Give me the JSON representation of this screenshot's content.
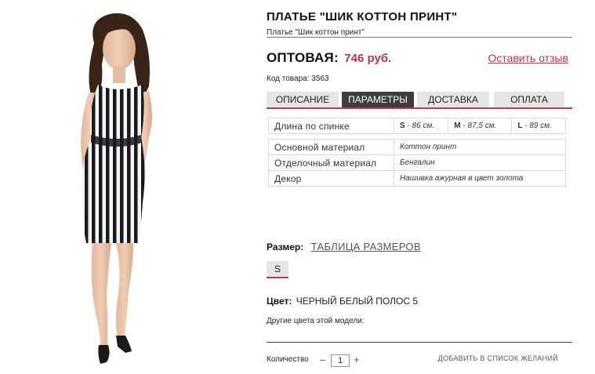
{
  "product": {
    "title": "ПЛАТЬЕ \"ШИК КОТТОН ПРИНТ\"",
    "subtitle": "Платье \"Шик коттон принт\"",
    "price_label": "ОПТОВАЯ:",
    "price_value": "746 руб.",
    "review_link": "Оставить отзыв",
    "sku": "Код товара: 3563"
  },
  "tabs": [
    {
      "label": "ОПИСАНИЕ",
      "active": false
    },
    {
      "label": "ПАРАМЕТРЫ",
      "active": true
    },
    {
      "label": "ДОСТАВКА",
      "active": false
    },
    {
      "label": "ОПЛАТА",
      "active": false
    }
  ],
  "length": {
    "label": "Длина по спинке",
    "sizes": [
      {
        "size": "S",
        "value": " - 86 см."
      },
      {
        "size": "M",
        "value": " - 87,5 см."
      },
      {
        "size": "L",
        "value": " - 89 см."
      }
    ]
  },
  "materials": [
    {
      "label": "Основной материал",
      "value": "Коттон принт"
    },
    {
      "label": "Отделочный материал",
      "value": "Бенгалин"
    },
    {
      "label": "Декор",
      "value": "Нашивка ажурная в цвет золота"
    }
  ],
  "size": {
    "label": "Размер:",
    "chart_link": "ТАБЛИЦА РАЗМЕРОВ",
    "options": [
      "S"
    ]
  },
  "color": {
    "label": "Цвет:",
    "value": "ЧЕРНЫЙ БЕЛЫЙ ПОЛОС 5",
    "other_colors": "Другие цвета этой модели:"
  },
  "purchase": {
    "qty_label": "Количество",
    "minus": "–",
    "qty_value": "1",
    "plus": "+",
    "wishlist": "ДОБАВИТЬ В СПИСОК ЖЕЛАНИЙ"
  },
  "colors": {
    "accent": "#c33a4e",
    "price": "#b0384a",
    "tab_active": "#3d3d3d",
    "tab_inactive": "#e6e6e6"
  }
}
